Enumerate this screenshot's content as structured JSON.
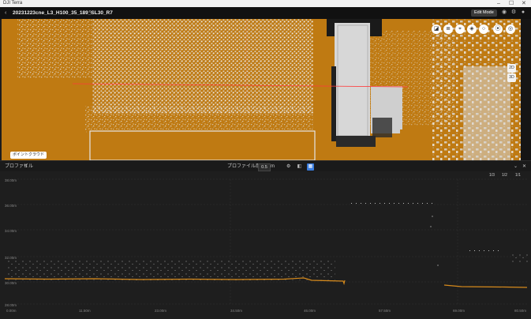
{
  "app": {
    "title": "DJI Terra"
  },
  "project": {
    "name": "20231223cne_L3_H100_35_189_SL30_R7"
  },
  "header": {
    "back_glyph": "‹",
    "edit_icon": "pencil-icon",
    "edit_mode_label": "Edit Mode"
  },
  "view": {
    "label": "ポイントクラウド",
    "side_buttons": [
      "2D",
      "3D"
    ]
  },
  "profile": {
    "label": "プロファイル",
    "thickness_label": "プロファイル厚",
    "thickness_value": "0.5",
    "thickness_unit": "m",
    "right_buttons": [
      "1/3",
      "1/2",
      "1/1"
    ],
    "y_ticks": [
      "38.00m",
      "36.00m",
      "34.00m",
      "32.00m",
      "30.00m",
      "28.00m"
    ],
    "x_ticks": [
      "0.00m",
      "11.50m",
      "23.00m",
      "34.50m",
      "46.00m",
      "57.50m",
      "69.00m",
      "80.50m"
    ]
  },
  "colors": {
    "point_cloud_bg": "#bf7a12",
    "profile_line": "#d68a1c",
    "accent": "#3b7ddd"
  }
}
